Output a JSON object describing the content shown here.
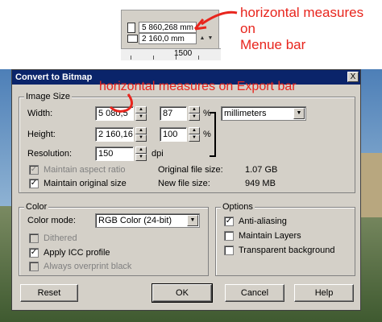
{
  "toolbar_excerpt": {
    "width_value": "5 860,268 mm",
    "height_value": "2 160,0 mm",
    "ruler_label": "1500"
  },
  "annotations": {
    "top": "horizontal measures on\nMenue bar",
    "dialog": "horizontal measures on Export bar"
  },
  "dialog": {
    "title": "Convert to Bitmap",
    "close_label": "X",
    "image_size": {
      "group_label": "Image Size",
      "width_label": "Width:",
      "width_value": "5 080,5",
      "width_percent": "87",
      "height_label": "Height:",
      "height_value": "2 160,16",
      "height_percent": "100",
      "percent_symbol": "%",
      "units": "millimeters",
      "resolution_label": "Resolution:",
      "resolution_value": "150",
      "resolution_unit": "dpi",
      "maintain_aspect_label": "Maintain aspect ratio",
      "maintain_aspect_checked": true,
      "maintain_aspect_disabled": true,
      "maintain_original_label": "Maintain original size",
      "maintain_original_checked": true,
      "original_size_label": "Original file size:",
      "original_size_value": "1.07 GB",
      "new_size_label": "New file size:",
      "new_size_value": "949 MB"
    },
    "color": {
      "group_label": "Color",
      "mode_label": "Color mode:",
      "mode_value": "RGB Color (24-bit)",
      "dithered_label": "Dithered",
      "apply_icc_label": "Apply ICC profile",
      "overprint_label": "Always overprint black"
    },
    "options": {
      "group_label": "Options",
      "anti_aliasing_label": "Anti-aliasing",
      "maintain_layers_label": "Maintain Layers",
      "transparent_bg_label": "Transparent background"
    },
    "buttons": {
      "reset": "Reset",
      "ok": "OK",
      "cancel": "Cancel",
      "help": "Help"
    }
  },
  "colors": {
    "annotation": "#e8251d",
    "titlebar": "#0a246a",
    "dialog_face": "#d4d0c8"
  }
}
